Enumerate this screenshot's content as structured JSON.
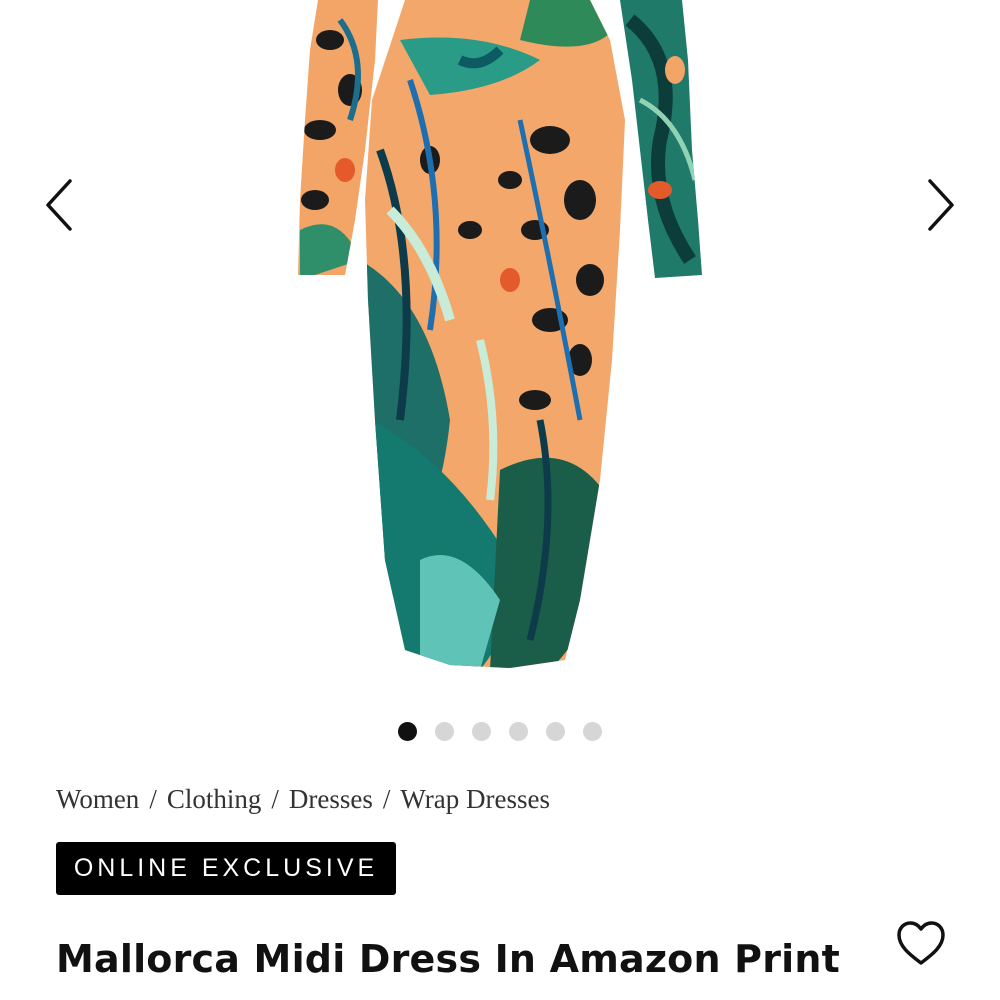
{
  "gallery": {
    "product_image_alt": "Mallorca Midi Dress In Amazon Print",
    "prev_icon": "chevron-left-icon",
    "next_icon": "chevron-right-icon",
    "dot_count": 6,
    "active_dot": 0
  },
  "breadcrumb": {
    "items": [
      "Women",
      "Clothing",
      "Dresses",
      "Wrap Dresses"
    ],
    "separator": "/"
  },
  "badge": {
    "label": "ONLINE EXCLUSIVE"
  },
  "product": {
    "title": "Mallorca Midi Dress In Amazon Print",
    "wishlist_icon": "heart-icon"
  },
  "colors": {
    "badge_bg": "#000000",
    "dot_active": "#111111",
    "dot_inactive": "#d6d6d6"
  }
}
